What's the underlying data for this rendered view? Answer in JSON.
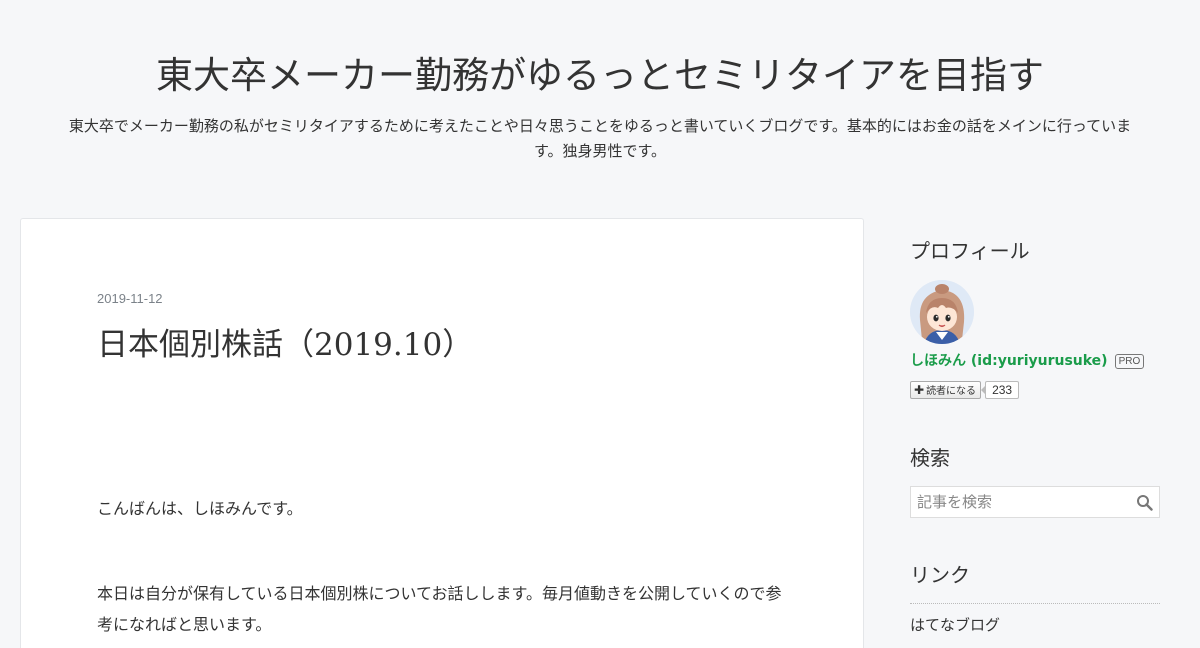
{
  "header": {
    "title": "東大卒メーカー勤務がゆるっとセミリタイアを目指す",
    "description": "東大卒でメーカー勤務の私がセミリタイアするために考えたことや日々思うことをゆるっと書いていくブログです。基本的にはお金の話をメインに行っています。独身男性です。"
  },
  "entry": {
    "date": "2019-11-12",
    "title": "日本個別株話（2019.10）",
    "paragraphs": [
      "こんばんは、しほみんです。",
      "本日は自分が保有している日本個別株についてお話しします。毎月値動きを公開していくので参考になればと思います。"
    ]
  },
  "sidebar": {
    "profile": {
      "title": "プロフィール",
      "name": "しほみん (id:yuriyurusuke)",
      "badge": "PRO",
      "subscribe_label": "読者になる",
      "subscriber_count": "233"
    },
    "search": {
      "title": "検索",
      "placeholder": "記事を検索"
    },
    "links": {
      "title": "リンク",
      "items": [
        "はてなブログ"
      ]
    }
  },
  "colors": {
    "background": "#f6f7f9",
    "card": "#ffffff",
    "profile_name": "#1a9c4a",
    "text": "#333333",
    "date": "#7b8289"
  },
  "icons": {
    "search": "magnifier-icon",
    "subscribe": "plus-icon",
    "avatar": "anime-girl-avatar"
  }
}
